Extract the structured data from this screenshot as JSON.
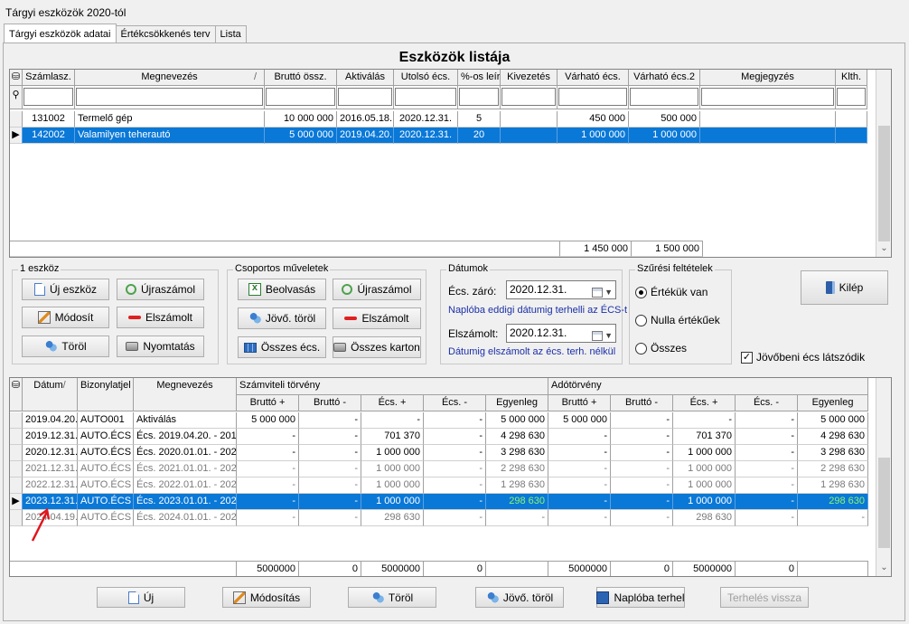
{
  "window": {
    "title": "Tárgyi eszközök 2020-tól"
  },
  "tabs": [
    "Tárgyi eszközök adatai",
    "Értékcsökkenés terv",
    "Lista"
  ],
  "list": {
    "title": "Eszközök listája",
    "columns": [
      "Számlasz.",
      "Megnevezés",
      "Bruttó össz.",
      "Aktiválás",
      "Utolsó écs.",
      "%-os leír.",
      "Kivezetés",
      "Várható écs.",
      "Várható écs.2",
      "Megjegyzés",
      "Klth."
    ],
    "sort_marker": "/",
    "rows": [
      [
        "131002",
        "Termelő gép",
        "10 000 000",
        "2016.05.18.",
        "2020.12.31.",
        "5",
        "",
        "450 000",
        "500 000",
        "",
        ""
      ],
      [
        "142002",
        "Valamilyen teherautó",
        "5 000 000",
        "2019.04.20.",
        "2020.12.31.",
        "20",
        "",
        "1 000 000",
        "1 000 000",
        "",
        ""
      ]
    ],
    "totals": {
      "varhato": "1 450 000",
      "varhato2": "1 500 000"
    }
  },
  "group_single": {
    "title": "1 eszköz",
    "buttons": [
      "Új eszköz",
      "Újraszámol",
      "Módosít",
      "Elszámolt",
      "Töröl",
      "Nyomtatás"
    ]
  },
  "group_bulk": {
    "title": "Csoportos műveletek",
    "buttons": [
      "Beolvasás",
      "Újraszámol",
      "Jövő. töröl",
      "Elszámolt",
      "Összes écs.",
      "Összes karton"
    ]
  },
  "dates": {
    "title": "Dátumok",
    "ecs_label": "Écs. záró:",
    "ecs_value": "2020.12.31.",
    "ecs_note": "Naplóba eddigi dátumig terhelli az ÉCS-t",
    "elsz_label": "Elszámolt:",
    "elsz_value": "2020.12.31.",
    "elsz_note": "Dátumig elszámolt az écs. terh. nélkül"
  },
  "filters": {
    "title": "Szűrési feltételek",
    "options": [
      "Értékük van",
      "Nulla értékűek",
      "Összes"
    ],
    "selected_index": 0
  },
  "exit_button": "Kilép",
  "future_checkbox": {
    "label": "Jövőbeni écs látszódik",
    "checked": true
  },
  "ledger": {
    "columns_left": [
      "Dátum",
      "Bizonylatjel",
      "Megnevezés"
    ],
    "group_sz": "Számviteli törvény",
    "group_ad": "Adótörvény",
    "sub_columns": [
      "Bruttó +",
      "Bruttó -",
      "Écs. +",
      "Écs. -",
      "Egyenleg"
    ],
    "rows": [
      {
        "style": "normal",
        "cells": [
          "2019.04.20.",
          "AUTO001",
          "Aktiválás",
          "5 000 000",
          "-",
          "-",
          "-",
          "5 000 000",
          "5 000 000",
          "-",
          "-",
          "-",
          "5 000 000"
        ]
      },
      {
        "style": "normal",
        "cells": [
          "2019.12.31.",
          "AUTO.ÉCS",
          "Écs. 2019.04.20. - 201",
          "-",
          "-",
          "701 370",
          "-",
          "4 298 630",
          "-",
          "-",
          "701 370",
          "-",
          "4 298 630"
        ]
      },
      {
        "style": "normal",
        "cells": [
          "2020.12.31.",
          "AUTO.ÉCS",
          "Écs. 2020.01.01. - 202",
          "-",
          "-",
          "1 000 000",
          "-",
          "3 298 630",
          "-",
          "-",
          "1 000 000",
          "-",
          "3 298 630"
        ]
      },
      {
        "style": "grey",
        "cells": [
          "2021.12.31.",
          "AUTO.ÉCS",
          "Écs. 2021.01.01. - 202",
          "-",
          "-",
          "1 000 000",
          "-",
          "2 298 630",
          "-",
          "-",
          "1 000 000",
          "-",
          "2 298 630"
        ]
      },
      {
        "style": "grey",
        "cells": [
          "2022.12.31.",
          "AUTO.ÉCS",
          "Écs. 2022.01.01. - 202",
          "-",
          "-",
          "1 000 000",
          "-",
          "1 298 630",
          "-",
          "-",
          "1 000 000",
          "-",
          "1 298 630"
        ]
      },
      {
        "style": "selected",
        "cells": [
          "2023.12.31.",
          "AUTO.ÉCS",
          "Écs. 2023.01.01. - 202",
          "-",
          "-",
          "1 000 000",
          "-",
          "298 630",
          "-",
          "-",
          "1 000 000",
          "-",
          "298 630"
        ]
      },
      {
        "style": "grey",
        "cells": [
          "2024.04.19.",
          "AUTO.ÉCS",
          "Écs. 2024.01.01. - 202",
          "-",
          "-",
          "298 630",
          "-",
          "-",
          "-",
          "-",
          "298 630",
          "-",
          "-"
        ]
      }
    ],
    "totals": [
      "5000000",
      "0",
      "5000000",
      "0",
      "",
      "5000000",
      "0",
      "5000000",
      "0",
      ""
    ]
  },
  "bottom_buttons": [
    "Új",
    "Módosítás",
    "Töröl",
    "Jövő. töröl",
    "Naplóba terhel",
    "Terhelés vissza"
  ],
  "colors": {
    "selection": "#0a78d7",
    "selection_green_text": "#8cf56a",
    "annotation_arrow": "#e0161e"
  }
}
